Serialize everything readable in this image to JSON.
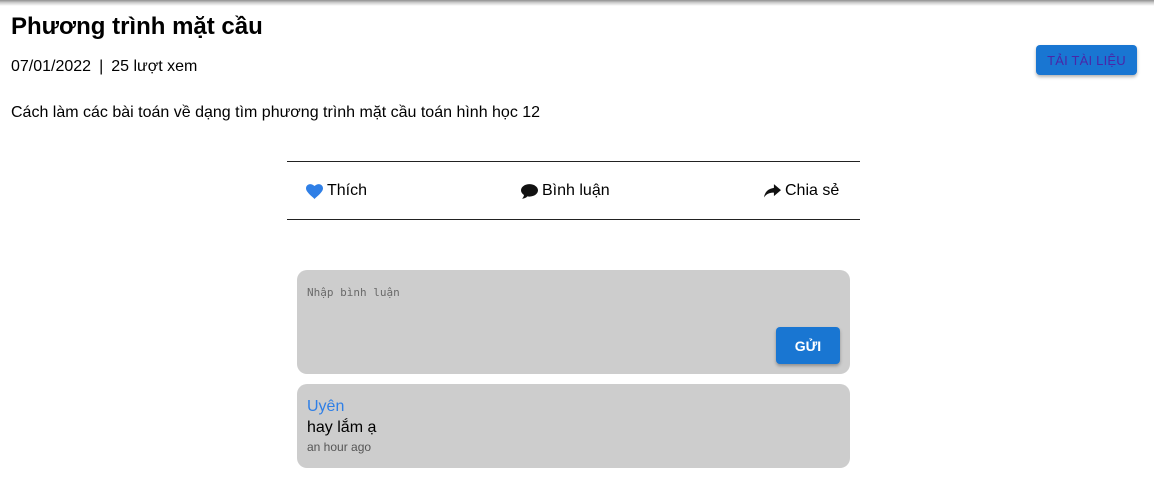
{
  "document": {
    "title": "Phương trình mặt cầu",
    "date": "07/01/2022",
    "separator": "|",
    "views": "25 lượt xem",
    "download_label": "TẢI TÀI LIỆU",
    "description": "Cách làm các bài toán về dạng tìm phương trình mặt cầu toán hình học 12"
  },
  "actions": {
    "like": {
      "label": "Thích",
      "icon": "heart-icon",
      "color": "#2f7fe6"
    },
    "comment": {
      "label": "Bình luận",
      "icon": "speech-bubble-icon"
    },
    "share": {
      "label": "Chia sẻ",
      "icon": "share-arrow-icon"
    }
  },
  "comment_form": {
    "placeholder": "Nhập bình luận",
    "send_label": "GỬI"
  },
  "comments": [
    {
      "author": "Uyên",
      "text": "hay lắm ạ",
      "time": "an hour ago"
    }
  ],
  "colors": {
    "primary_button": "#1976d2",
    "card_background": "#cdcdcd",
    "author_link": "#2f7fe6"
  }
}
